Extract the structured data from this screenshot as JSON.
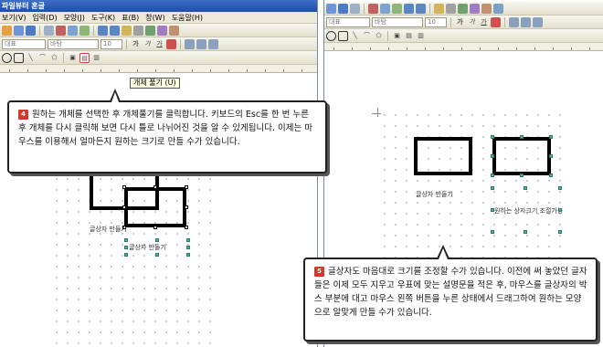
{
  "left_window": {
    "title": "파일뷰터 혼글",
    "menu": [
      "보기(V)",
      "입력(D)",
      "모양(J)",
      "도구(K)",
      "표(B)",
      "창(W)",
      "도움말(H)"
    ],
    "font_placeholder": "대표",
    "style_field": "바탕",
    "size_field": "10",
    "tooltip": "개체 풀기 (U)",
    "labels": {
      "box_label_1": "글상자 만들기",
      "box_label_2": "글상자 만들기"
    }
  },
  "right_window": {
    "font_placeholder": "대표",
    "style_field": "바탕",
    "size_field": "10",
    "labels": {
      "box_label_1": "글상자 만들기",
      "box_label_2": "원하는 상자크기 조절가능"
    }
  },
  "callout_4": {
    "step": "4",
    "text": "원하는 개체를 선택한 후 개체풀기를 클릭합니다. 키보드의 Esc를 한 번 누른 후 개체를 다시 클릭해 보면 다시 틀로 나뉘어진 것을 알 수 있게됩니다. 이제는 마우스를 이용해서 얼마든지 원하는 크기로 만들 수가 있습니다."
  },
  "callout_5": {
    "step": "5",
    "text": "글상자도 마음대로 크기를 조정할 수가 있습니다. 이전에 써 놓았던 글자들은 이제 모두 지우고 우표에 맞는 설명문을 적은 후, 마우스를 글상자의 박스 부분에 대고 마우스 왼쪽 버튼을 누른 상태에서 드래그하여 원하는 모양으로 알맞게 만들 수가 있습니다."
  }
}
